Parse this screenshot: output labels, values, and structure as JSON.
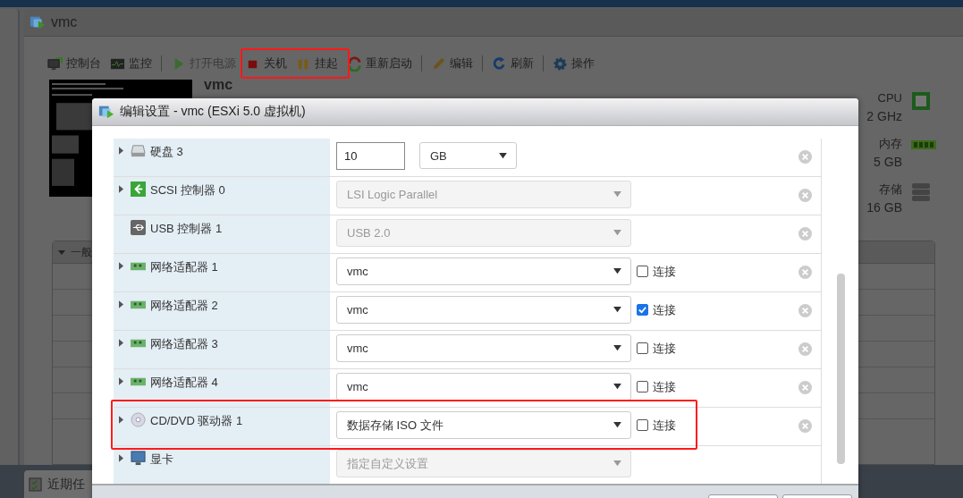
{
  "app_window": {
    "title": "vmc"
  },
  "toolbar": [
    [
      {
        "label": "控制台",
        "disabled": false
      },
      {
        "label": "监控",
        "disabled": false
      }
    ],
    [
      {
        "label": "打开电源",
        "disabled": true
      },
      {
        "label": "关机",
        "disabled": false
      },
      {
        "label": "挂起",
        "disabled": false
      },
      {
        "label": "重新启动",
        "disabled": false
      }
    ],
    [
      {
        "label": "编辑",
        "disabled": false
      }
    ],
    [
      {
        "label": "刷新",
        "disabled": false
      }
    ],
    [
      {
        "label": "操作",
        "disabled": false
      }
    ]
  ],
  "vm_name": "vmc",
  "stats": [
    {
      "label": "CPU",
      "value": "2 GHz"
    },
    {
      "label": "内存",
      "value": "5 GB"
    },
    {
      "label": "存储",
      "value": "16 GB"
    }
  ],
  "general_panel": {
    "title": "一般"
  },
  "tasks_bar": {
    "title": "近期任"
  },
  "dialog": {
    "title": "编辑设置 - vmc (ESXi 5.0 虚拟机)",
    "devices": [
      {
        "kind": "disk",
        "expandable": true,
        "label": "硬盘 3",
        "size": "10",
        "unit": "GB",
        "removable": true
      },
      {
        "kind": "scsi",
        "expandable": true,
        "label": "SCSI 控制器 0",
        "value": "LSI Logic Parallel",
        "disabled": true,
        "removable": true
      },
      {
        "kind": "usb",
        "expandable": false,
        "label": "USB 控制器 1",
        "value": "USB 2.0",
        "disabled": true,
        "removable": true
      },
      {
        "kind": "nic",
        "expandable": true,
        "label": "网络适配器 1",
        "value": "vmc",
        "disabled": false,
        "removable": true,
        "connect": {
          "label": "连接",
          "checked": false
        }
      },
      {
        "kind": "nic",
        "expandable": true,
        "label": "网络适配器 2",
        "value": "vmc",
        "disabled": false,
        "removable": true,
        "connect": {
          "label": "连接",
          "checked": true
        }
      },
      {
        "kind": "nic",
        "expandable": true,
        "label": "网络适配器 3",
        "value": "vmc",
        "disabled": false,
        "removable": true,
        "connect": {
          "label": "连接",
          "checked": false
        }
      },
      {
        "kind": "nic",
        "expandable": true,
        "label": "网络适配器 4",
        "value": "vmc",
        "disabled": false,
        "removable": true,
        "connect": {
          "label": "连接",
          "checked": false
        }
      },
      {
        "kind": "cd",
        "expandable": true,
        "label": "CD/DVD 驱动器 1",
        "value": "数据存储 ISO 文件",
        "disabled": false,
        "removable": true,
        "connect": {
          "label": "连接",
          "checked": false
        }
      },
      {
        "kind": "display",
        "expandable": true,
        "label": "显卡",
        "value": "指定自定义设置",
        "disabled": true,
        "removable": false
      }
    ]
  }
}
